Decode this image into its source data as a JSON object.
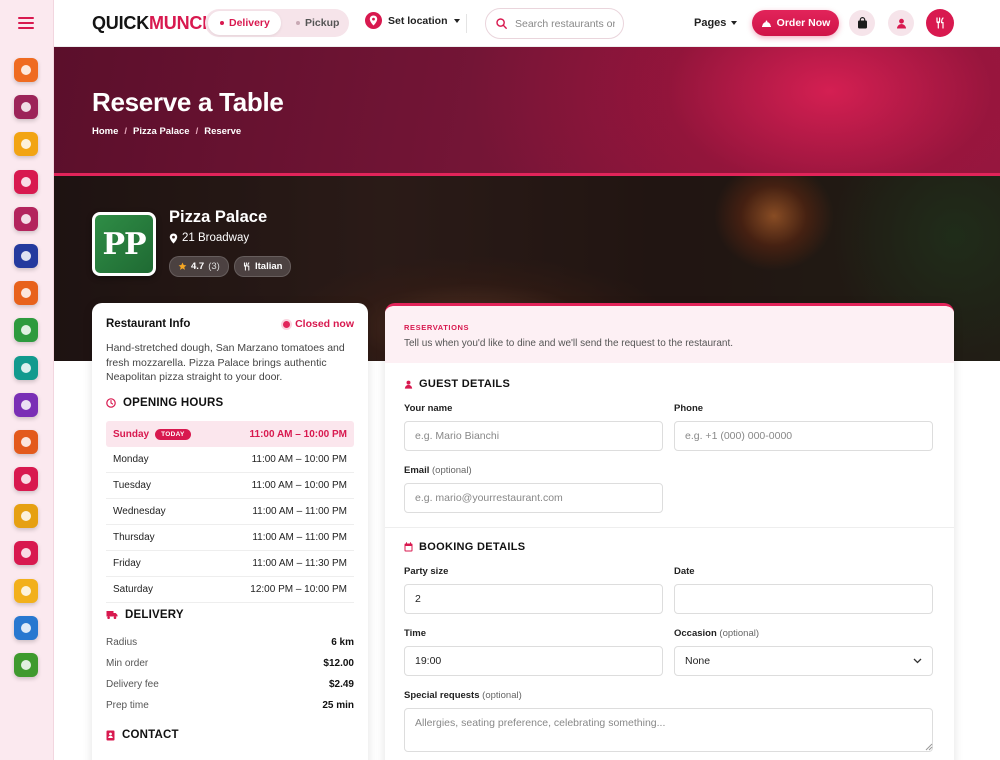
{
  "header": {
    "logo_dark": "QUICK",
    "logo_accent": "MUNCH.",
    "mode_delivery": "Delivery",
    "mode_pickup": "Pickup",
    "location_label": "Set location",
    "search_placeholder": "Search restaurants or dishes",
    "pages_label": "Pages",
    "order_now_label": "Order Now"
  },
  "sidebar": {
    "category_colors": [
      "#ef6b21",
      "#9c2459",
      "#f2a413",
      "#d8194f",
      "#b3245d",
      "#243a9e",
      "#e8621c",
      "#2e9a3e",
      "#129a8e",
      "#7a2fb5",
      "#e35a1c",
      "#d8194f",
      "#e6a012",
      "#d8194f",
      "#f2b01c",
      "#2878d0",
      "#3f9a2e"
    ]
  },
  "hero": {
    "title": "Reserve a Table",
    "breadcrumb": [
      "Home",
      "Pizza Palace",
      "Reserve"
    ]
  },
  "restaurant": {
    "logo_text": "PP",
    "name": "Pizza Palace",
    "address": "21 Broadway",
    "rating": "4.7",
    "rating_count": "(3)",
    "cuisine": "Italian"
  },
  "info": {
    "title": "Restaurant Info",
    "status": "Closed now",
    "description": "Hand-stretched dough, San Marzano tomatoes and fresh mozzarella. Pizza Palace brings authentic Neapolitan pizza straight to your door.",
    "hours_title": "OPENING HOURS",
    "today_badge": "TODAY",
    "hours": [
      {
        "day": "Sunday",
        "time": "11:00 AM – 10:00 PM"
      },
      {
        "day": "Monday",
        "time": "11:00 AM – 10:00 PM"
      },
      {
        "day": "Tuesday",
        "time": "11:00 AM – 10:00 PM"
      },
      {
        "day": "Wednesday",
        "time": "11:00 AM – 11:00 PM"
      },
      {
        "day": "Thursday",
        "time": "11:00 AM – 11:00 PM"
      },
      {
        "day": "Friday",
        "time": "11:00 AM – 11:30 PM"
      },
      {
        "day": "Saturday",
        "time": "12:00 PM – 10:00 PM"
      }
    ],
    "delivery_title": "DELIVERY",
    "delivery": [
      {
        "label": "Radius",
        "value": "6 km"
      },
      {
        "label": "Min order",
        "value": "$12.00"
      },
      {
        "label": "Delivery fee",
        "value": "$2.49"
      },
      {
        "label": "Prep time",
        "value": "25 min"
      }
    ],
    "contact_title": "CONTACT"
  },
  "reservation": {
    "eyebrow": "RESERVATIONS",
    "subtitle": "Tell us when you'd like to dine and we'll send the request to the restaurant.",
    "guest_title": "GUEST DETAILS",
    "name_label": "Your name",
    "name_placeholder": "e.g. Mario Bianchi",
    "phone_label": "Phone",
    "phone_placeholder": "e.g. +1 (000) 000-0000",
    "email_label": "Email",
    "email_optional": "(optional)",
    "email_placeholder": "e.g. mario@yourrestaurant.com",
    "booking_title": "BOOKING DETAILS",
    "party_label": "Party size",
    "party_value": "2",
    "date_label": "Date",
    "date_value": "",
    "time_label": "Time",
    "time_value": "19:00",
    "occasion_label": "Occasion",
    "occasion_optional": "(optional)",
    "occasion_value": "None",
    "requests_label": "Special requests",
    "requests_optional": "(optional)",
    "requests_placeholder": "Allergies, seating preference, celebrating something..."
  },
  "colors": {
    "accent": "#d8194f",
    "hero_dark": "#5b0f2b",
    "tint": "#fbe6ed"
  }
}
